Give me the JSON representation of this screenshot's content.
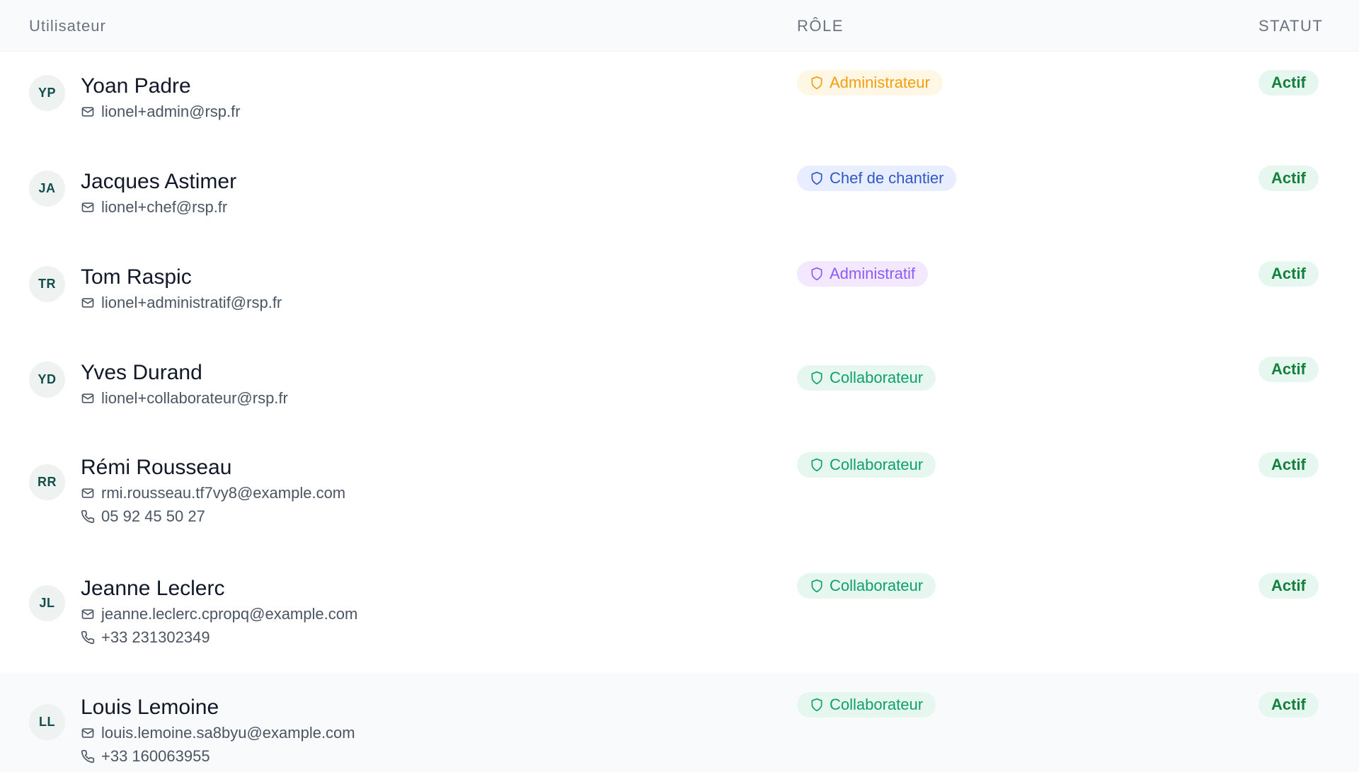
{
  "columns": {
    "user": "Utilisateur",
    "role": "RÔLE",
    "status": "STATUT"
  },
  "colors": {
    "admin_bg": "#fff7e6",
    "admin_fg": "#f59e0b",
    "chef_bg": "#e8eeff",
    "chef_fg": "#2f57c8",
    "administratif_bg": "#f3e8ff",
    "administratif_fg": "#8b5cf6",
    "collab_bg": "#e6f7ef",
    "collab_fg": "#0f9f6e",
    "status_bg": "#e6f7ef",
    "status_fg": "#15803d"
  },
  "users": [
    {
      "initials": "YP",
      "name": "Yoan Padre",
      "email": "lionel+admin@rsp.fr",
      "phone": null,
      "role": "Administrateur",
      "role_kind": "admin",
      "status": "Actif"
    },
    {
      "initials": "JA",
      "name": "Jacques Astimer",
      "email": "lionel+chef@rsp.fr",
      "phone": null,
      "role": "Chef de chantier",
      "role_kind": "chef",
      "status": "Actif"
    },
    {
      "initials": "TR",
      "name": "Tom Raspic",
      "email": "lionel+administratif@rsp.fr",
      "phone": null,
      "role": "Administratif",
      "role_kind": "administratif",
      "status": "Actif"
    },
    {
      "initials": "YD",
      "name": "Yves Durand",
      "email": "lionel+collaborateur@rsp.fr",
      "phone": null,
      "role": "Collaborateur",
      "role_kind": "collab",
      "status": "Actif"
    },
    {
      "initials": "RR",
      "name": "Rémi Rousseau",
      "email": "rmi.rousseau.tf7vy8@example.com",
      "phone": "05 92 45 50 27",
      "role": "Collaborateur",
      "role_kind": "collab",
      "status": "Actif"
    },
    {
      "initials": "JL",
      "name": "Jeanne Leclerc",
      "email": "jeanne.leclerc.cpropq@example.com",
      "phone": "+33 231302349",
      "role": "Collaborateur",
      "role_kind": "collab",
      "status": "Actif"
    },
    {
      "initials": "LL",
      "name": "Louis Lemoine",
      "email": "louis.lemoine.sa8byu@example.com",
      "phone": "+33 160063955",
      "role": "Collaborateur",
      "role_kind": "collab",
      "status": "Actif"
    }
  ],
  "icons": {
    "email": "mail-icon",
    "phone": "phone-icon",
    "role": "shield-icon"
  }
}
